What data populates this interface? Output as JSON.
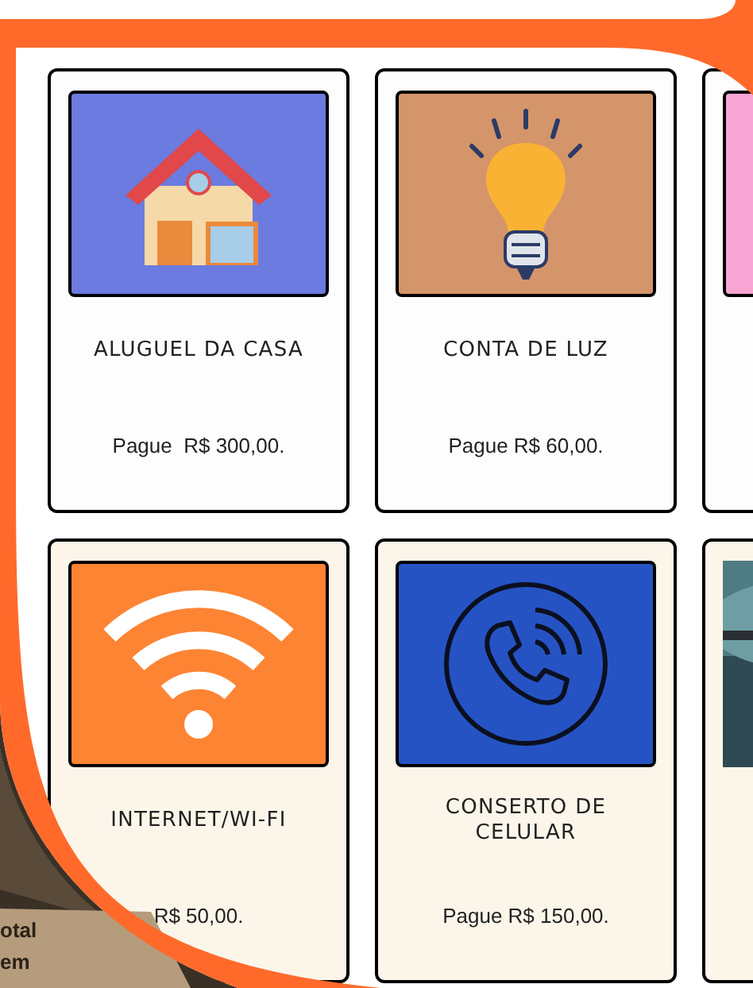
{
  "rows": [
    {
      "kind": "plain",
      "cards": [
        {
          "kind": "house",
          "color": "#6b7be0",
          "title": "ALUGUEL DA CASA",
          "price": "Pague  R$ 300,00."
        },
        {
          "kind": "bulb",
          "color": "#d4956a",
          "title": "CONTA DE LUZ",
          "price": "Pague R$ 60,00."
        },
        {
          "kind": "blank",
          "color": "#f7a6d4"
        }
      ]
    },
    {
      "kind": "cream",
      "cards": [
        {
          "kind": "wifi",
          "color": "#fd8433",
          "title": "INTERNET/WI-FI",
          "price": "R$ 50,00."
        },
        {
          "kind": "phone",
          "color": "#2653c4",
          "title": "CONSERTO DE CELULAR",
          "price": "Pague R$ 150,00."
        },
        {
          "kind": "picture"
        }
      ]
    }
  ],
  "corner_panel": {
    "lines": [
      "otal",
      "em"
    ]
  }
}
